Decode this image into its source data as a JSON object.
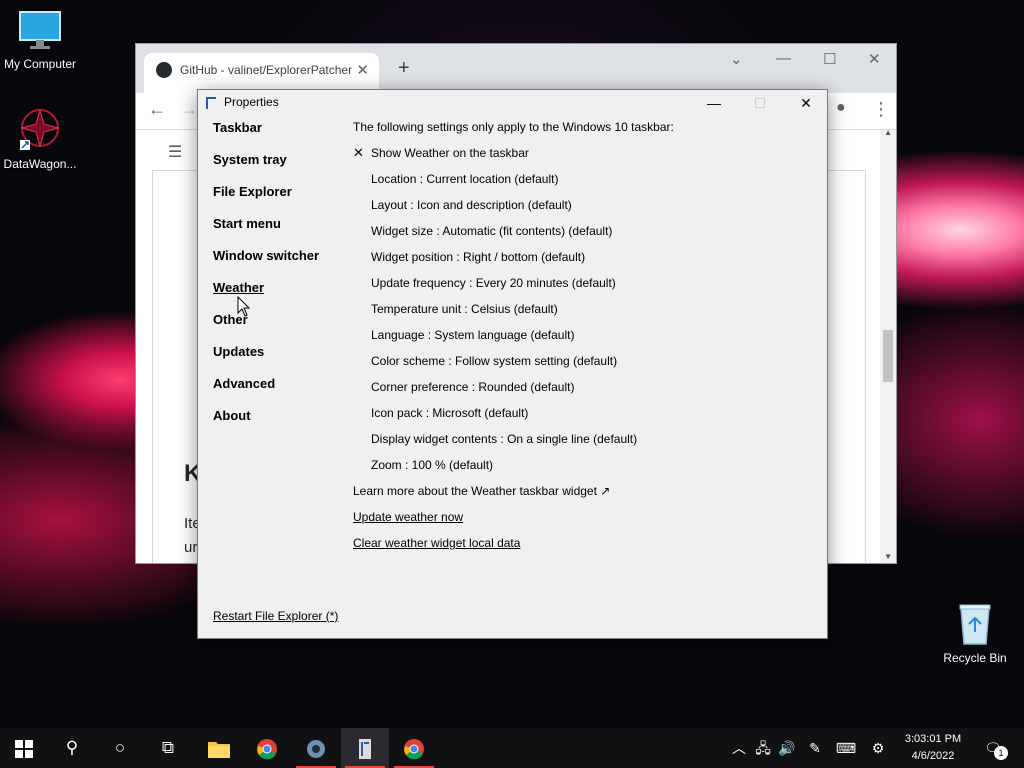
{
  "desktop": {
    "icons": [
      {
        "label": "My Computer"
      },
      {
        "label": "DataWagon..."
      },
      {
        "label": "Recycle Bin"
      }
    ]
  },
  "browser": {
    "tab_title": "GitHub - valinet/ExplorerPatcher",
    "page_heading_partial": "K",
    "page_text_line1": "Ite",
    "page_text_line2": "ur"
  },
  "dialog": {
    "title": "Properties",
    "sidebar": [
      {
        "label": "Taskbar"
      },
      {
        "label": "System tray"
      },
      {
        "label": "File Explorer"
      },
      {
        "label": "Start menu"
      },
      {
        "label": "Window switcher"
      },
      {
        "label": "Weather",
        "active": true
      },
      {
        "label": "Other"
      },
      {
        "label": "Updates"
      },
      {
        "label": "Advanced"
      },
      {
        "label": "About"
      }
    ],
    "intro": "The following settings only apply to the Windows 10 taskbar:",
    "show_weather": {
      "label": "Show Weather on the taskbar",
      "checked": true
    },
    "settings": [
      {
        "label": "Location : Current location (default)"
      },
      {
        "label": "Layout : Icon and description (default)"
      },
      {
        "label": "Widget size : Automatic (fit contents) (default)"
      },
      {
        "label": "Widget position : Right / bottom (default)"
      },
      {
        "label": "Update frequency : Every 20 minutes (default)"
      },
      {
        "label": "Temperature unit : Celsius (default)"
      },
      {
        "label": "Language : System language (default)"
      },
      {
        "label": "Color scheme : Follow system setting (default)"
      },
      {
        "label": "Corner preference : Rounded (default)"
      },
      {
        "label": "Icon pack : Microsoft (default)"
      },
      {
        "label": "Display widget contents : On a single line (default)"
      },
      {
        "label": "Zoom : 100 % (default)"
      }
    ],
    "learn_more": "Learn more about the Weather taskbar widget ↗",
    "update_now": "Update weather now",
    "clear_data": "Clear weather widget local data",
    "restart": "Restart File Explorer (*)"
  },
  "taskbar": {
    "time": "3:03:01 PM",
    "date": "4/6/2022",
    "notification_count": "1"
  }
}
